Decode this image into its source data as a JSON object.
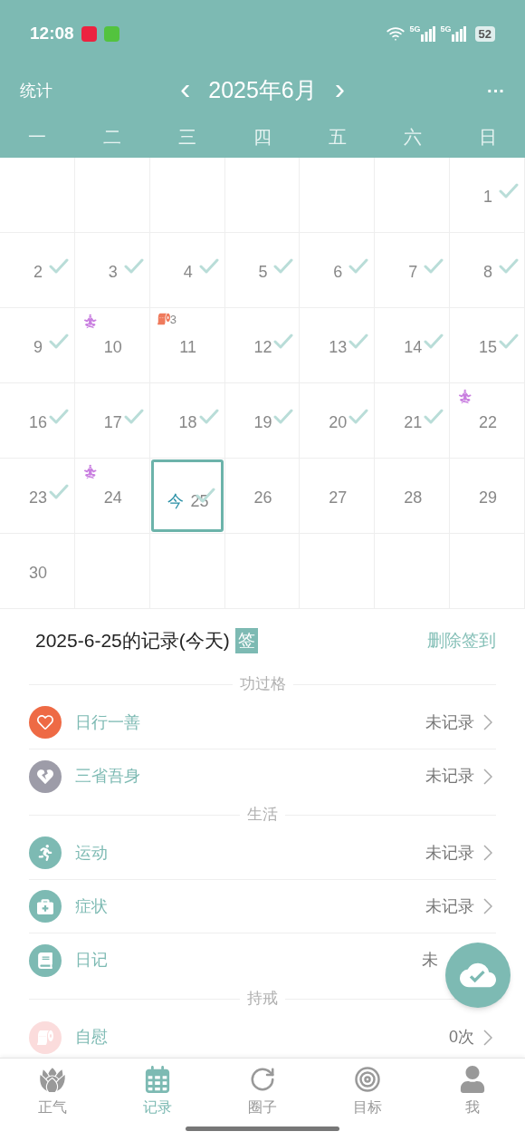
{
  "status_bar": {
    "time": "12:08",
    "network_1": "5G",
    "network_2": "5G",
    "battery": "52"
  },
  "header": {
    "left": "统计",
    "prev": "‹",
    "title": "2025年6月",
    "next": "›",
    "more": "···"
  },
  "weekdays": [
    "一",
    "二",
    "三",
    "四",
    "五",
    "六",
    "日"
  ],
  "calendar": {
    "today_label": "今",
    "days": [
      {
        "kind": "blank"
      },
      {
        "kind": "blank"
      },
      {
        "kind": "blank"
      },
      {
        "kind": "blank"
      },
      {
        "kind": "blank"
      },
      {
        "kind": "blank"
      },
      {
        "day": "1",
        "checked": true,
        "selected": false
      },
      {
        "day": "2",
        "checked": true,
        "selected": false
      },
      {
        "day": "3",
        "checked": true,
        "selected": false
      },
      {
        "day": "4",
        "checked": true,
        "selected": false
      },
      {
        "day": "5",
        "checked": true,
        "selected": false
      },
      {
        "day": "6",
        "checked": true,
        "selected": false
      },
      {
        "day": "7",
        "checked": true,
        "selected": false
      },
      {
        "day": "8",
        "checked": true,
        "selected": false
      },
      {
        "day": "9",
        "checked": true,
        "selected": false
      },
      {
        "day": "10",
        "checked": false,
        "selected": false,
        "mark": {
          "kind": "meditation"
        }
      },
      {
        "day": "11",
        "checked": false,
        "selected": false,
        "mark": {
          "kind": "roll",
          "count": "3"
        }
      },
      {
        "day": "12",
        "checked": true,
        "selected": false
      },
      {
        "day": "13",
        "checked": true,
        "selected": false
      },
      {
        "day": "14",
        "checked": true,
        "selected": false
      },
      {
        "day": "15",
        "checked": true,
        "selected": false
      },
      {
        "day": "16",
        "checked": true,
        "selected": false
      },
      {
        "day": "17",
        "checked": true,
        "selected": false
      },
      {
        "day": "18",
        "checked": true,
        "selected": false
      },
      {
        "day": "19",
        "checked": true,
        "selected": false
      },
      {
        "day": "20",
        "checked": true,
        "selected": false
      },
      {
        "day": "21",
        "checked": true,
        "selected": false
      },
      {
        "day": "22",
        "checked": false,
        "selected": false,
        "mark": {
          "kind": "meditation"
        }
      },
      {
        "day": "23",
        "checked": true,
        "selected": false
      },
      {
        "day": "24",
        "checked": false,
        "selected": false,
        "mark": {
          "kind": "meditation"
        }
      },
      {
        "day": "25",
        "checked": true,
        "selected": true,
        "today": true
      },
      {
        "day": "26",
        "checked": false,
        "selected": false
      },
      {
        "day": "27",
        "checked": false,
        "selected": false
      },
      {
        "day": "28",
        "checked": false,
        "selected": false
      },
      {
        "day": "29",
        "checked": false,
        "selected": false
      },
      {
        "day": "30",
        "checked": false,
        "selected": false
      }
    ]
  },
  "record": {
    "title": "2025-6-25的记录(今天)",
    "badge": "签",
    "action": "删除签到",
    "sections": [
      {
        "label": "功过格",
        "rows": [
          {
            "label": "日行一善",
            "value": "未记录",
            "color": "#ee6a45",
            "chevron": true
          },
          {
            "label": "三省吾身",
            "value": "未记录",
            "color": "#9d9ca8",
            "chevron": true
          }
        ]
      },
      {
        "label": "生活",
        "rows": [
          {
            "label": "运动",
            "value": "未记录",
            "color": "#7dbab3",
            "chevron": true
          },
          {
            "label": "症状",
            "value": "未记录",
            "color": "#7dbab3",
            "chevron": true
          },
          {
            "label": "日记",
            "value": "未",
            "color": "#7dbab3",
            "chevron": false
          }
        ]
      },
      {
        "label": "持戒",
        "rows": [
          {
            "label": "自慰",
            "value": "0次",
            "color": "#fbdcdc",
            "chevron": true
          }
        ]
      }
    ]
  },
  "tabs": [
    {
      "label": "正气",
      "selected": false
    },
    {
      "label": "记录",
      "selected": true
    },
    {
      "label": "圈子",
      "selected": false
    },
    {
      "label": "目标",
      "selected": false
    },
    {
      "label": "我",
      "selected": false
    }
  ]
}
